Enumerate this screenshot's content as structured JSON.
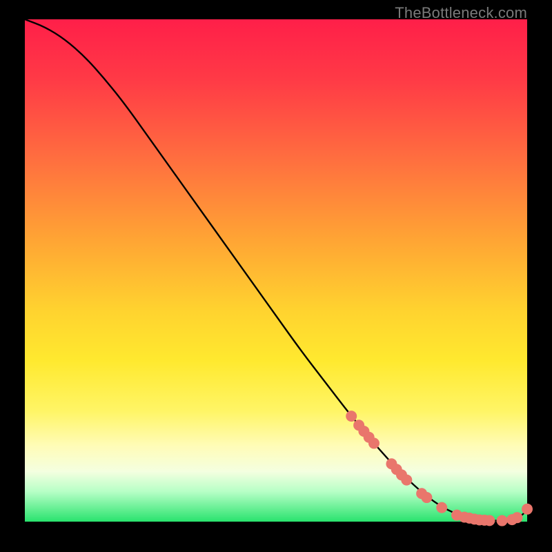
{
  "watermark": "TheBottleneck.com",
  "chart_data": {
    "type": "line",
    "title": "",
    "xlabel": "",
    "ylabel": "",
    "xlim": [
      0,
      100
    ],
    "ylim": [
      0,
      100
    ],
    "grid": false,
    "legend": false,
    "series": [
      {
        "name": "bottleneck-curve",
        "x": [
          0,
          4,
          8,
          12,
          16,
          20,
          25,
          30,
          35,
          40,
          45,
          50,
          55,
          60,
          65,
          70,
          75,
          80,
          84,
          88,
          91,
          93,
          95,
          97,
          99,
          100
        ],
        "y": [
          100,
          98.5,
          96,
          92.5,
          88,
          83,
          76,
          69,
          62,
          55,
          48,
          41,
          34,
          27.5,
          21,
          15,
          9.5,
          5,
          2.3,
          0.8,
          0.3,
          0.2,
          0.2,
          0.4,
          1.2,
          2.5
        ]
      }
    ],
    "markers": [
      {
        "x": 65.0,
        "y": 21.0
      },
      {
        "x": 66.5,
        "y": 19.2
      },
      {
        "x": 67.5,
        "y": 18.0
      },
      {
        "x": 68.5,
        "y": 16.8
      },
      {
        "x": 69.5,
        "y": 15.6
      },
      {
        "x": 73.0,
        "y": 11.5
      },
      {
        "x": 74.0,
        "y": 10.4
      },
      {
        "x": 75.0,
        "y": 9.3
      },
      {
        "x": 76.0,
        "y": 8.3
      },
      {
        "x": 79.0,
        "y": 5.6
      },
      {
        "x": 80.0,
        "y": 4.8
      },
      {
        "x": 83.0,
        "y": 2.8
      },
      {
        "x": 86.0,
        "y": 1.3
      },
      {
        "x": 87.5,
        "y": 0.9
      },
      {
        "x": 88.5,
        "y": 0.7
      },
      {
        "x": 89.5,
        "y": 0.5
      },
      {
        "x": 90.5,
        "y": 0.35
      },
      {
        "x": 91.5,
        "y": 0.3
      },
      {
        "x": 92.5,
        "y": 0.22
      },
      {
        "x": 95.0,
        "y": 0.2
      },
      {
        "x": 97.0,
        "y": 0.4
      },
      {
        "x": 98.0,
        "y": 0.8
      },
      {
        "x": 100.0,
        "y": 2.5
      }
    ],
    "marker_style": {
      "color": "#e9766c",
      "radius_px": 8
    }
  }
}
